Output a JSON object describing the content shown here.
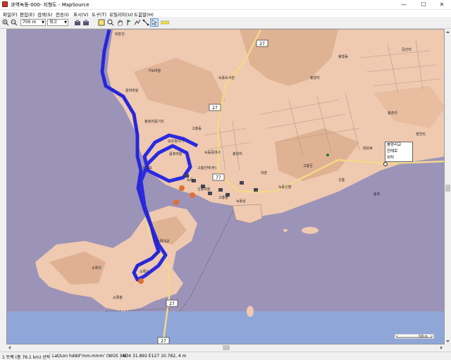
{
  "window": {
    "title": "과역녹동-000- 지형도 - MapSource",
    "minimize": "—",
    "maximize": "☐",
    "close": "✕"
  },
  "menu": [
    {
      "label": "파일(F)"
    },
    {
      "label": "편집(E)"
    },
    {
      "label": "검색(S)"
    },
    {
      "label": "전송(I)"
    },
    {
      "label": "표시(V)"
    },
    {
      "label": "도구(T)"
    },
    {
      "label": "유틸리티(U)"
    },
    {
      "label": "도움말(H)"
    }
  ],
  "toolbar": {
    "zoom_value": "700 m",
    "detail_value": "최고"
  },
  "map": {
    "road_shields": [
      "27",
      "27",
      "77",
      "77",
      "27",
      "27"
    ],
    "place_labels": [
      "대촌진",
      "용마마을",
      "가모마을",
      "봉정리용기지",
      "보조청사거",
      "고흥동",
      "신고포",
      "음포마을",
      "녹동",
      "신풍마을",
      "봉양리",
      "대촌",
      "녹동중대구",
      "고흥민박(주)",
      "녹동남",
      "고흥항",
      "녹동신항",
      "고흥군",
      "녹동도서관",
      "봉양리",
      "소록도",
      "소록리",
      "소록항",
      "소록대교",
      "대보로",
      "신흥",
      "율포",
      "봉촌리",
      "금산리",
      "봉황동",
      "명천리"
    ],
    "popup": {
      "header": "봉양리교",
      "items": [
        "현재로",
        "위치"
      ]
    },
    "scale": "700 m"
  },
  "status": {
    "track_info": "1 트랙 (총 76.1 km) 선택",
    "coord_format": "Lat/Lon hddd°mm.mmm' (WGS 84)",
    "position": "N34 31.892 E127 10.762, 4 m"
  },
  "colors": {
    "water": "#9c93b8",
    "sea": "#8fa6d8",
    "land": "#efc9b0",
    "terrain": "#d9a888",
    "track": "#2a2ae0",
    "highway": "#f2d98a"
  }
}
